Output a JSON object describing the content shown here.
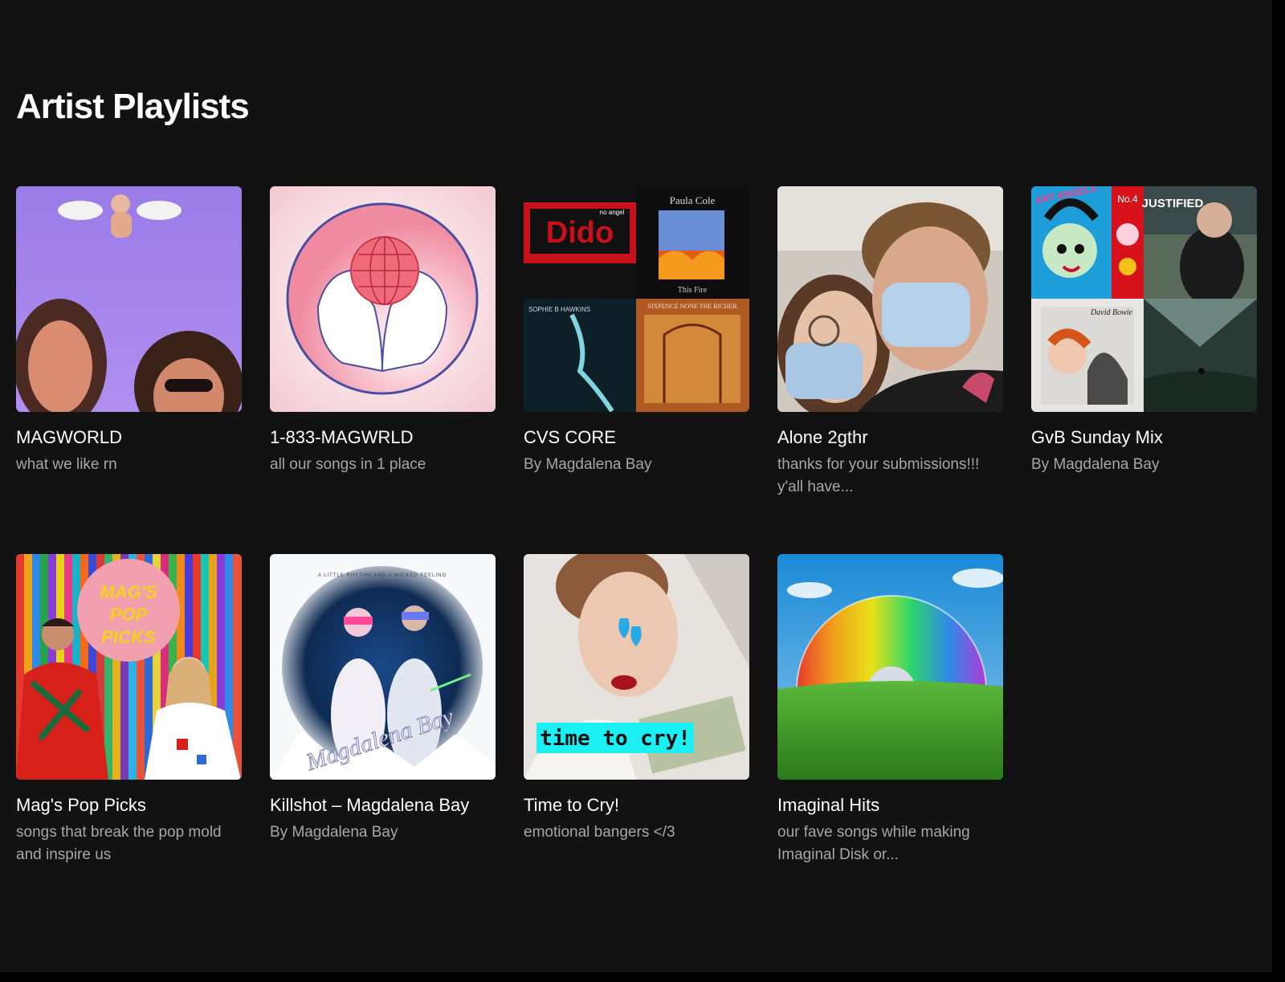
{
  "section": {
    "title": "Artist Playlists"
  },
  "playlists": [
    {
      "name": "MAGWORLD",
      "description": "what we like rn",
      "cover_icon": "magworld-cover"
    },
    {
      "name": "1-833-MAGWRLD",
      "description": "all our songs in 1 place",
      "cover_icon": "hands-globe-cover"
    },
    {
      "name": "CVS CORE",
      "description": "By Magdalena Bay",
      "cover_icon": "album-mosaic-cover",
      "cover_text": {
        "t1": "Dido",
        "t1b": "no angel",
        "t2": "Paula Cole",
        "t2b": "This Fire",
        "t3": "SOPHIE B HAWKINS",
        "t4": "SIXPENCE NONE THE RICHER"
      }
    },
    {
      "name": "Alone 2gthr",
      "description": "thanks for your submissions!!! y'all have...",
      "cover_icon": "selfie-cover"
    },
    {
      "name": "GvB Sunday Mix",
      "description": "By Magdalena Bay",
      "cover_icon": "album-mosaic-cover",
      "cover_text": {
        "t1": "ART ANGELS",
        "t2": "JUSTIFIED",
        "t3": "No.4",
        "t4": "David Bowie"
      }
    },
    {
      "name": "Mag's Pop Picks",
      "description": "songs that break the pop mold and inspire us",
      "cover_icon": "pop-picks-cover",
      "cover_text": {
        "l1": "MAG'S",
        "l2": "POP",
        "l3": "PICKS"
      }
    },
    {
      "name": "Killshot – Magdalena Bay",
      "description": "By Magdalena Bay",
      "cover_icon": "killshot-cover",
      "cover_text": {
        "top": "A LITTLE RHYTHM AND A WICKED FEELING",
        "logo": "Magdalena Bay"
      }
    },
    {
      "name": "Time to Cry!",
      "description": "emotional bangers </3",
      "cover_icon": "time-to-cry-cover",
      "cover_text": {
        "caption": "time to cry!"
      }
    },
    {
      "name": "Imaginal Hits",
      "description": "our fave songs while making Imaginal Disk or...",
      "cover_icon": "rainbow-disc-cover"
    }
  ]
}
